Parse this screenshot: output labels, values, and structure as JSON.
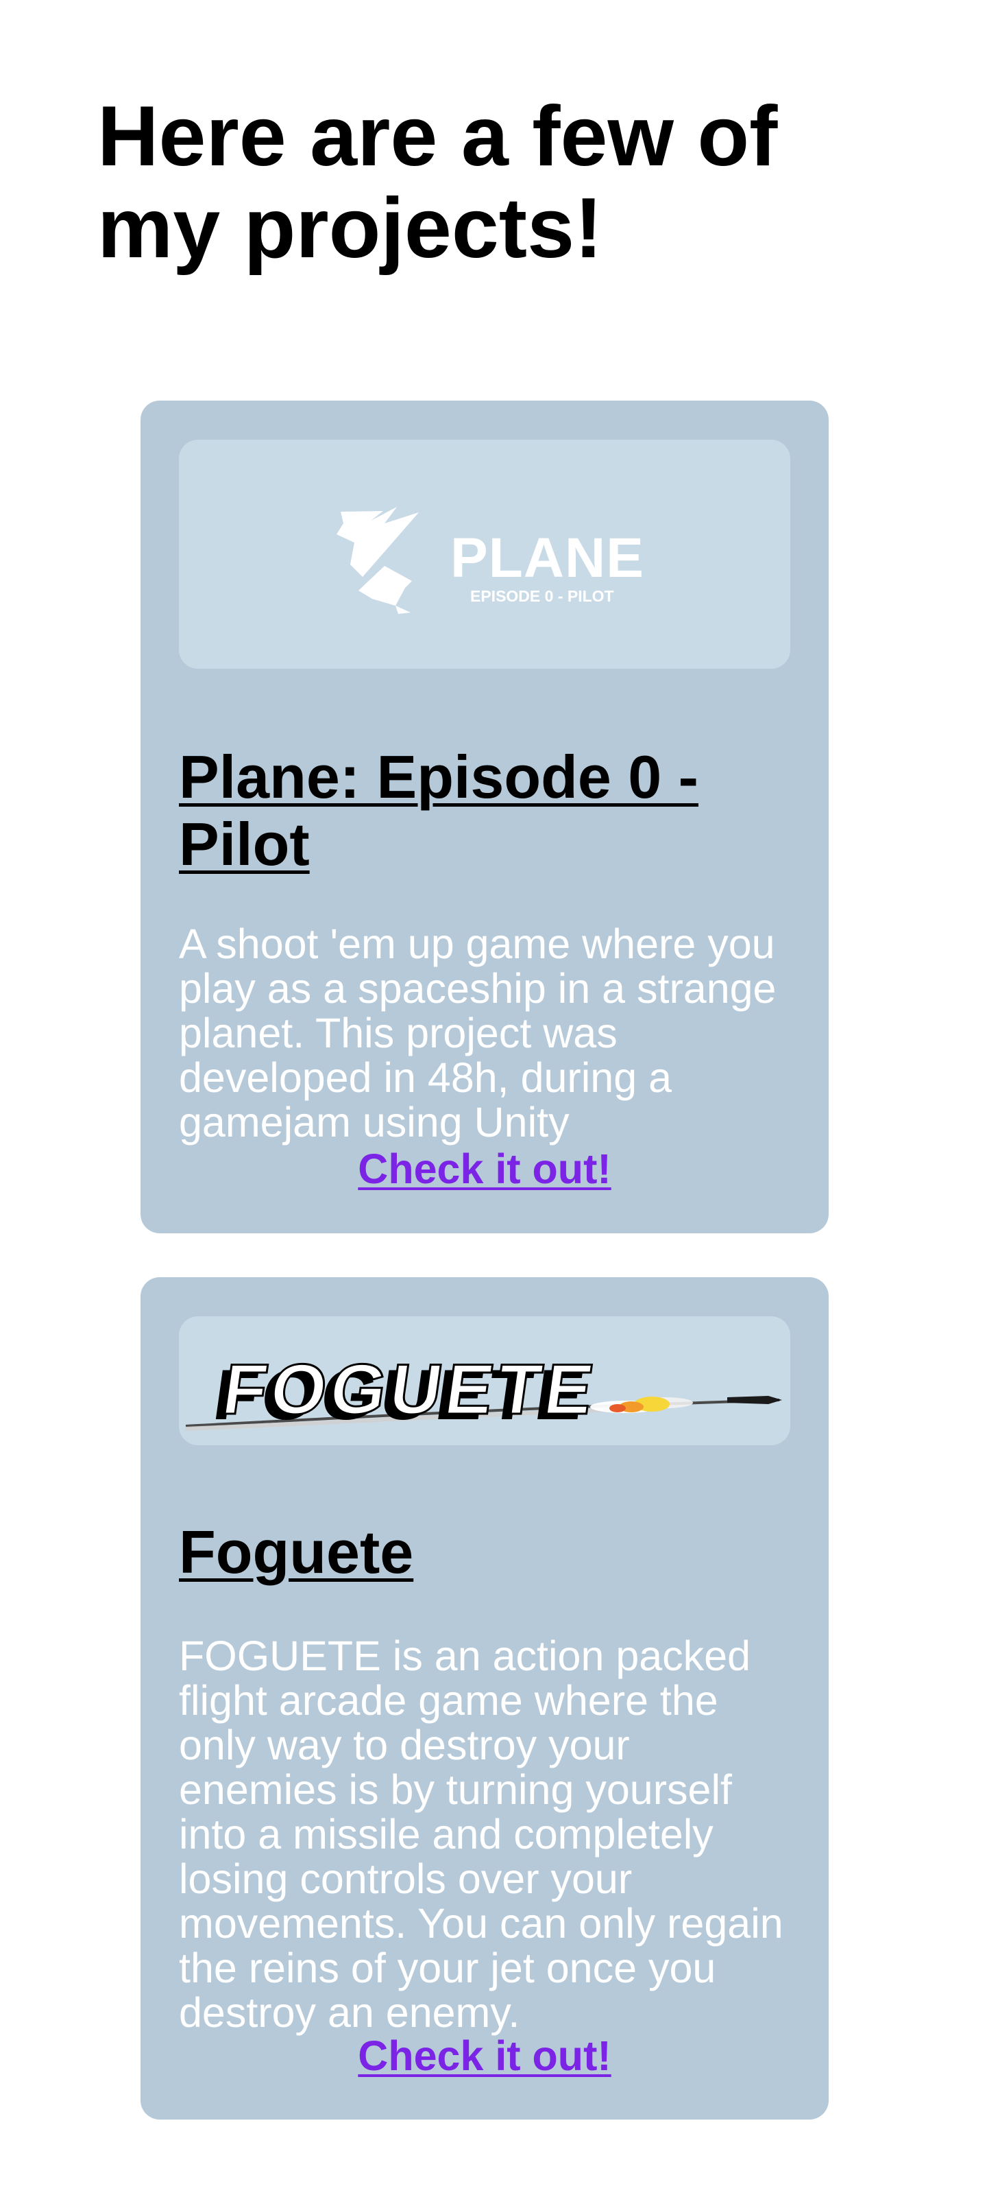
{
  "header": {
    "title": "Here are a few of my projects!"
  },
  "projects": [
    {
      "logo_text": "PLANE",
      "logo_subtext": "EPISODE 0 - PILOT",
      "title": "Plane: Episode 0 - Pilot",
      "description": "A shoot 'em up game where you play as a spaceship in a strange planet. This project was developed in 48h, during a gamejam using Unity",
      "link_label": "Check it out!"
    },
    {
      "logo_text": "FOGUETE",
      "title": "Foguete",
      "description": "FOGUETE is an action packed flight arcade game where the only way to destroy your enemies is by turning yourself into a missile and completely losing controls over your movements. You can only regain the reins of your jet once you destroy an enemy.",
      "link_label": "Check it out!"
    }
  ],
  "colors": {
    "card_background": "#b6c9d8",
    "thumbnail_background": "#c9dae7",
    "description_text": "#ffffff",
    "link": "#7b24e6"
  },
  "icons": {
    "plane_logo": "plane-logo-icon",
    "foguete_logo": "foguete-logo-icon"
  }
}
